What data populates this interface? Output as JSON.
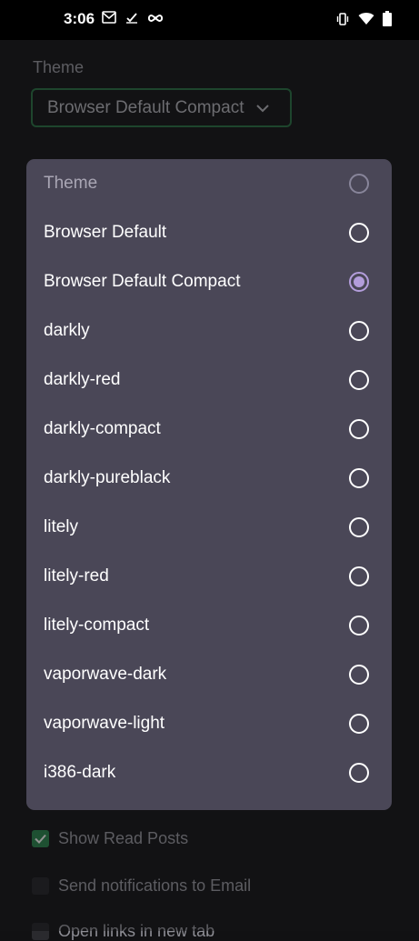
{
  "status_bar": {
    "time": "3:06"
  },
  "background": {
    "theme_label": "Theme",
    "theme_value": "Browser Default Compact",
    "checkboxes": [
      {
        "label": "Show Read Posts",
        "checked": true
      },
      {
        "label": "Send notifications to Email",
        "checked": false
      },
      {
        "label": "Open links in new tab",
        "checked": false
      }
    ]
  },
  "dialog": {
    "title": "Theme",
    "options": [
      {
        "label": "Browser Default",
        "selected": false
      },
      {
        "label": "Browser Default Compact",
        "selected": true
      },
      {
        "label": "darkly",
        "selected": false
      },
      {
        "label": "darkly-red",
        "selected": false
      },
      {
        "label": "darkly-compact",
        "selected": false
      },
      {
        "label": "darkly-pureblack",
        "selected": false
      },
      {
        "label": "litely",
        "selected": false
      },
      {
        "label": "litely-red",
        "selected": false
      },
      {
        "label": "litely-compact",
        "selected": false
      },
      {
        "label": "vaporwave-dark",
        "selected": false
      },
      {
        "label": "vaporwave-light",
        "selected": false
      },
      {
        "label": "i386-dark",
        "selected": false
      }
    ]
  }
}
